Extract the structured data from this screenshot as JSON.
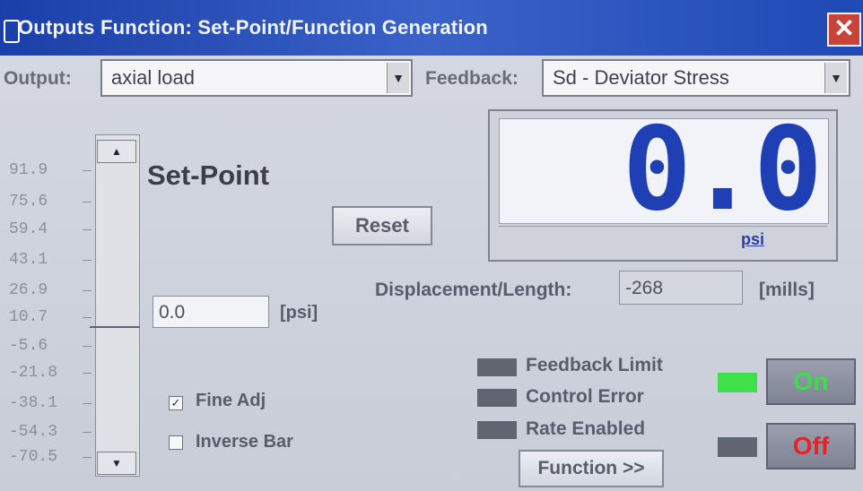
{
  "window": {
    "title": "Outputs Function: Set-Point/Function Generation",
    "close_label": "✕"
  },
  "output": {
    "label": "Output:",
    "value": "axial load"
  },
  "feedback": {
    "label": "Feedback:",
    "value": "Sd - Deviator Stress"
  },
  "scale": {
    "ticks": [
      "91.9",
      "75.6",
      "59.4",
      "43.1",
      "26.9",
      "10.7",
      "-5.6",
      "-21.8",
      "-38.1",
      "-54.3",
      "-70.5"
    ],
    "up_arrow": "▲",
    "down_arrow": "▼"
  },
  "setpoint": {
    "heading": "Set-Point",
    "value": "0.0",
    "unit": "[psi]",
    "reset_label": "Reset"
  },
  "readout": {
    "value": "0.0",
    "unit": "psi"
  },
  "displacement": {
    "label": "Displacement/Length:",
    "value": "-268",
    "unit": "[mills]"
  },
  "options": {
    "fine_adj": {
      "label": "Fine Adj",
      "checked": true,
      "mark": "✓"
    },
    "inverse_bar": {
      "label": "Inverse Bar",
      "checked": false,
      "mark": ""
    }
  },
  "status": [
    {
      "label": "Feedback Limit",
      "color": "#5f6571"
    },
    {
      "label": "Control Error",
      "color": "#5f6571"
    },
    {
      "label": "Rate Enabled",
      "color": "#5f6571"
    }
  ],
  "function_button": "Function >>",
  "power": {
    "on_label": "On",
    "on_color": "#3fdc4b",
    "on_led": "#3fe04a",
    "off_label": "Off",
    "off_color": "#e2252a",
    "off_led": "#5f6571"
  }
}
